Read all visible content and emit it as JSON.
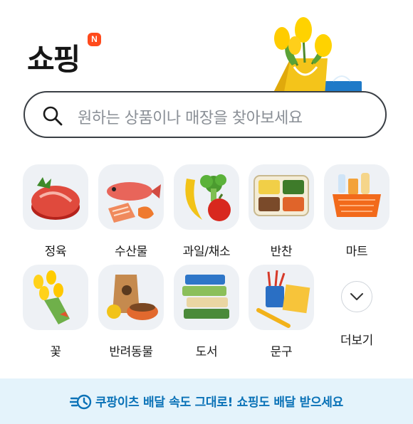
{
  "header": {
    "title": "쇼핑",
    "badge": "N"
  },
  "search": {
    "placeholder": "원하는 상품이나 매장을 찾아보세요"
  },
  "categories": [
    {
      "label": "정육",
      "icon": "meat-icon"
    },
    {
      "label": "수산물",
      "icon": "fish-icon"
    },
    {
      "label": "과일/채소",
      "icon": "fruit-vegetable-icon"
    },
    {
      "label": "반찬",
      "icon": "side-dish-icon"
    },
    {
      "label": "마트",
      "icon": "basket-icon"
    },
    {
      "label": "꽃",
      "icon": "flower-icon"
    },
    {
      "label": "반려동물",
      "icon": "pet-food-icon"
    },
    {
      "label": "도서",
      "icon": "books-icon"
    },
    {
      "label": "문구",
      "icon": "stationery-icon"
    }
  ],
  "more": {
    "label": "더보기",
    "icon": "chevron-down-icon"
  },
  "banner": {
    "text": "쿠팡이츠 배달 속도 그대로! 쇼핑도 배달 받으세요",
    "icon": "fast-delivery-icon",
    "color": "#0a72b7"
  }
}
